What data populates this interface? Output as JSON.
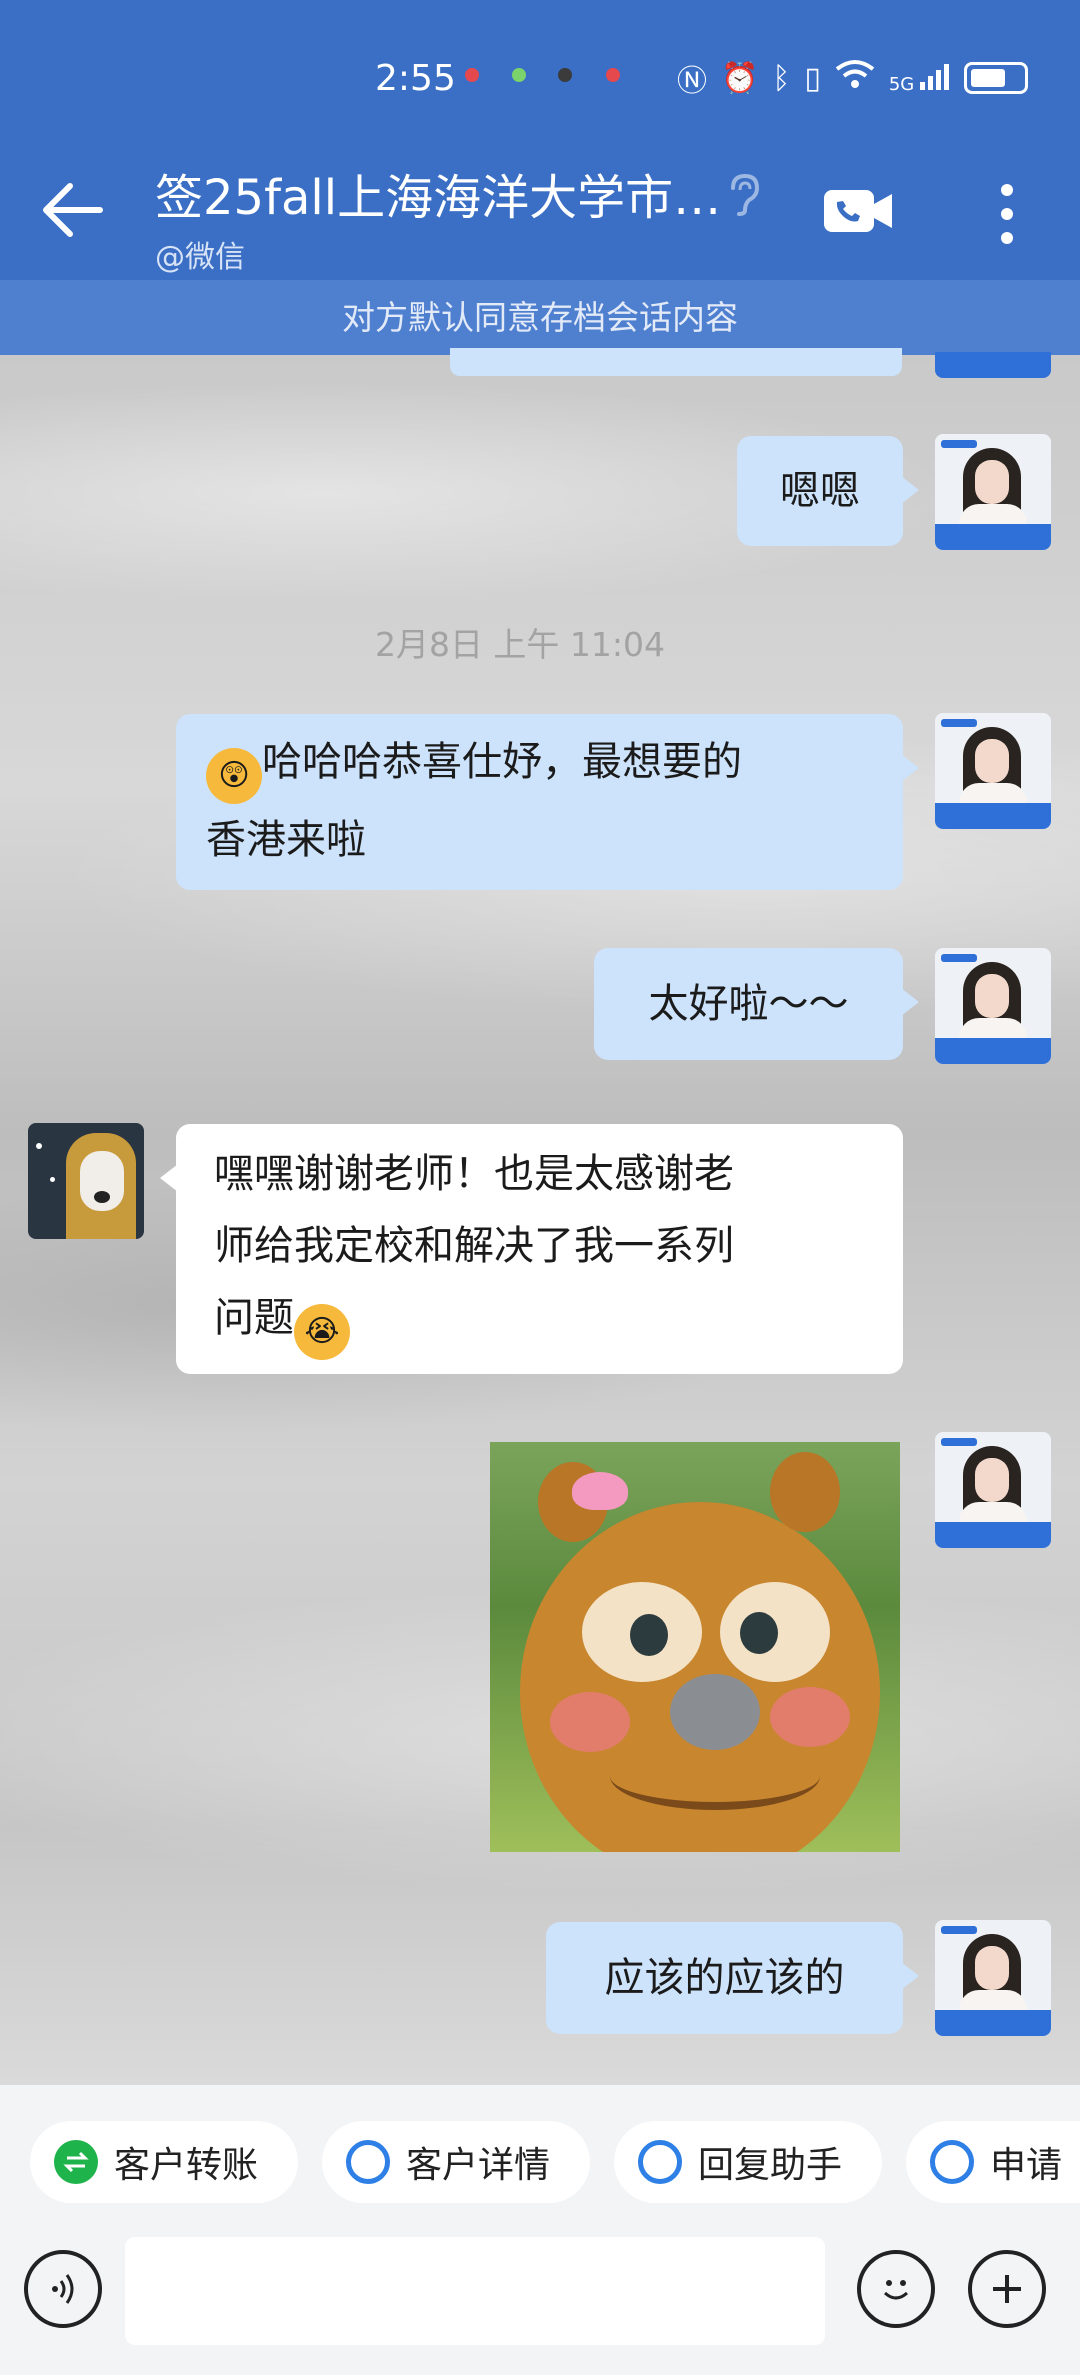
{
  "status_bar": {
    "time": "2:55",
    "network": "5G"
  },
  "header": {
    "title": "签25fall上海海洋大学市…",
    "subtitle": "@微信",
    "notice": "对方默认同意存档会话内容"
  },
  "messages": {
    "m1": "嗯嗯",
    "timestamp": "2月8日 上午 11:04",
    "m2_line1": "哈哈哈恭喜仕妤，最想要的",
    "m2_line2": "香港来啦",
    "m3": "太好啦～～",
    "m4_line1": "嘿嘿谢谢老师！也是太感谢老",
    "m4_line2": "师给我定校和解决了我一系列",
    "m4_line3": "问题",
    "m5": "应该的应该的"
  },
  "quick_actions": [
    {
      "label": "客户转账",
      "icon": "transfer-icon",
      "color": "#1fb34b"
    },
    {
      "label": "客户详情",
      "icon": "customer-detail-icon",
      "color": "#2e80e6"
    },
    {
      "label": "回复助手",
      "icon": "reply-assistant-icon",
      "color": "#2e80e6"
    },
    {
      "label": "申请",
      "icon": "apply-icon",
      "color": "#2e80e6"
    }
  ],
  "icons": {
    "back": "back-arrow-icon",
    "ear": "ear-icon",
    "call": "video-call-icon",
    "more": "more-icon",
    "voice": "voice-icon",
    "emoji": "emoji-icon",
    "plus": "plus-icon"
  },
  "colors": {
    "header": "#3a6fc5",
    "notice": "#4f7fcf",
    "bubble_out": "#cde3fb",
    "bubble_in": "#ffffff"
  }
}
